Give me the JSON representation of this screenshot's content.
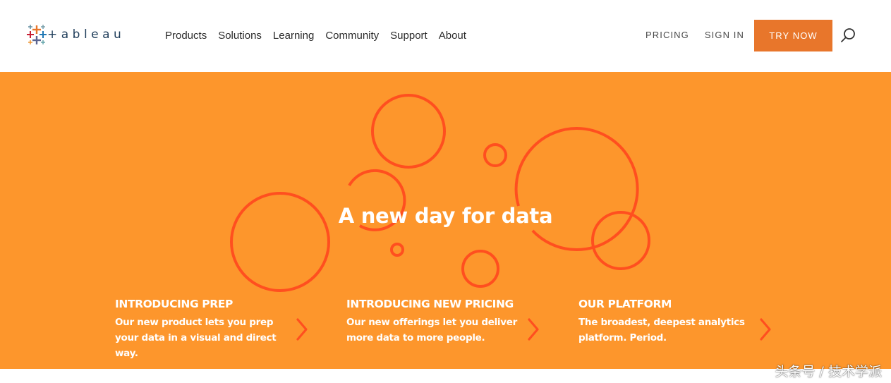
{
  "brand": {
    "name": "tableau",
    "colors": {
      "accent": "#e8762b",
      "hero_bg": "#fd962c",
      "circle": "#ff4f1f",
      "logo_text": "#1f3d5a"
    }
  },
  "nav": {
    "items": [
      {
        "label": "Products"
      },
      {
        "label": "Solutions"
      },
      {
        "label": "Learning"
      },
      {
        "label": "Community"
      },
      {
        "label": "Support"
      },
      {
        "label": "About"
      }
    ]
  },
  "utility_nav": {
    "pricing": "PRICING",
    "sign_in": "SIGN IN",
    "try_now": "TRY NOW",
    "search_icon": "search-icon"
  },
  "hero": {
    "title": "A new day for data"
  },
  "features": [
    {
      "title": "INTRODUCING PREP",
      "description": "Our new product lets you prep your data in a visual and direct way."
    },
    {
      "title": "INTRODUCING NEW PRICING",
      "description": "Our new offerings let you deliver more data to more people."
    },
    {
      "title": "OUR PLATFORM",
      "description": "The broadest, deepest analytics platform. Period."
    }
  ],
  "watermark": "头条号 / 技术学派"
}
